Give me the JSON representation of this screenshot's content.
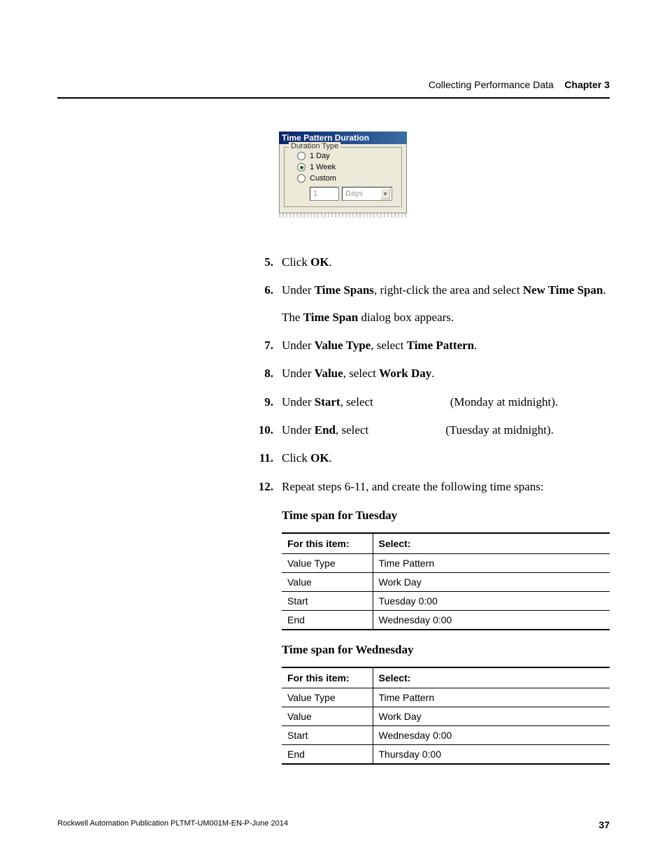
{
  "header": {
    "section": "Collecting Performance Data",
    "chapter": "Chapter 3"
  },
  "dialog": {
    "title": "Time Pattern Duration",
    "legend": "Duration Type",
    "options": {
      "day": "1 Day",
      "week": "1 Week",
      "custom": "Custom"
    },
    "num": "1",
    "unit": "Days"
  },
  "steps": {
    "s5": {
      "n": "5.",
      "t1": "Click ",
      "b1": "OK",
      "t2": "."
    },
    "s6": {
      "n": "6.",
      "t1": "Under ",
      "b1": "Time Spans",
      "t2": ", right-click the area and select ",
      "b2": "New Time Span",
      "t3": ".",
      "p2a": "The ",
      "p2b": "Time Span",
      "p2c": " dialog box appears."
    },
    "s7": {
      "n": "7.",
      "t1": "Under ",
      "b1": "Value Type",
      "t2": ", select ",
      "b2": "Time Pattern",
      "t3": "."
    },
    "s8": {
      "n": "8.",
      "t1": "Under ",
      "b1": "Value",
      "t2": ", select ",
      "b2": "Work Day",
      "t3": "."
    },
    "s9": {
      "n": "9.",
      "t1": "Under ",
      "b1": "Start",
      "t2": ", select",
      "note": "(Monday at midnight)."
    },
    "s10": {
      "n": "10.",
      "t1": "Under ",
      "b1": "End",
      "t2": ", select",
      "note": "(Tuesday at midnight)."
    },
    "s11": {
      "n": "11.",
      "t1": "Click ",
      "b1": "OK",
      "t2": "."
    },
    "s12": {
      "n": "12.",
      "t1": "Repeat steps 6-11, and create the following time spans:"
    }
  },
  "tables": {
    "tue": {
      "title": "Time span for Tuesday",
      "h1": "For this item:",
      "h2": "Select:",
      "rows": [
        {
          "a": "Value Type",
          "b": "Time Pattern"
        },
        {
          "a": "Value",
          "b": "Work Day"
        },
        {
          "a": "Start",
          "b": "Tuesday 0:00"
        },
        {
          "a": "End",
          "b": "Wednesday 0:00"
        }
      ]
    },
    "wed": {
      "title": "Time span for Wednesday",
      "h1": "For this item:",
      "h2": "Select:",
      "rows": [
        {
          "a": "Value Type",
          "b": "Time Pattern"
        },
        {
          "a": "Value",
          "b": "Work Day"
        },
        {
          "a": "Start",
          "b": "Wednesday 0:00"
        },
        {
          "a": "End",
          "b": "Thursday 0:00"
        }
      ]
    }
  },
  "footer": {
    "pub": "Rockwell Automation Publication PLTMT-UM001M-EN-P-June 2014",
    "page": "37"
  }
}
